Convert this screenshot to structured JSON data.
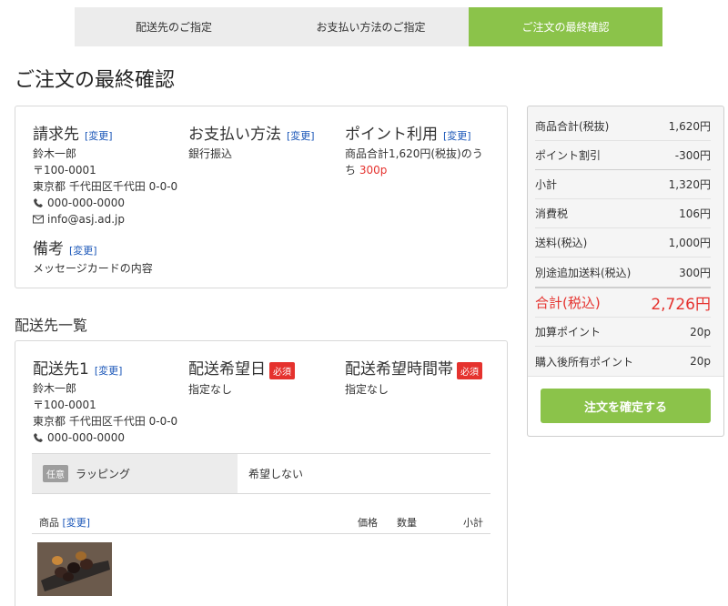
{
  "steps": [
    "配送先のご指定",
    "お支払い方法のご指定",
    "ご注文の最終確認"
  ],
  "page_title": "ご注文の最終確認",
  "change_label": "[変更]",
  "billing": {
    "title": "請求先",
    "name": "鈴木一郎",
    "postal": "〒100-0001",
    "address": "東京都 千代田区千代田 0-0-0",
    "phone": "000-000-0000",
    "email": "info@asj.ad.jp"
  },
  "payment": {
    "title": "お支払い方法",
    "method": "銀行振込"
  },
  "points": {
    "title": "ポイント利用",
    "text": "商品合計1,620円(税抜)のう",
    "text2": "ち",
    "value": "300p"
  },
  "remarks": {
    "title": "備考",
    "text": "メッセージカードの内容"
  },
  "delivery_list_title": "配送先一覧",
  "delivery": {
    "title": "配送先1",
    "name": "鈴木一郎",
    "postal": "〒100-0001",
    "address": "東京都 千代田区千代田 0-0-0",
    "phone": "000-000-0000",
    "date_title": "配送希望日",
    "date_value": "指定なし",
    "time_title": "配送希望時間帯",
    "time_value": "指定なし",
    "required_badge": "必須"
  },
  "wrapping": {
    "badge": "任意",
    "label": "ラッピング",
    "value": "希望しない"
  },
  "table_headers": {
    "product": "商品",
    "change": "[変更]",
    "price": "価格",
    "qty": "数量",
    "subtotal": "小計"
  },
  "summary": {
    "rows": [
      {
        "label": "商品合計(税抜)",
        "value": "1,620円"
      },
      {
        "label": "ポイント割引",
        "value": "-300円"
      },
      {
        "label": "小計",
        "value": "1,320円"
      },
      {
        "label": "消費税",
        "value": "106円"
      },
      {
        "label": "送料(税込)",
        "value": "1,000円"
      },
      {
        "label": "別途追加送料(税込)",
        "value": "300円"
      }
    ],
    "total": {
      "label": "合計(税込)",
      "value": "2,726円"
    },
    "points_rows": [
      {
        "label": "加算ポイント",
        "value": "20p"
      },
      {
        "label": "購入後所有ポイント",
        "value": "20p"
      }
    ],
    "confirm_button": "注文を確定する"
  },
  "colors": {
    "accent": "#8bc34a",
    "required": "#e5322e",
    "link": "#1a56b8"
  }
}
